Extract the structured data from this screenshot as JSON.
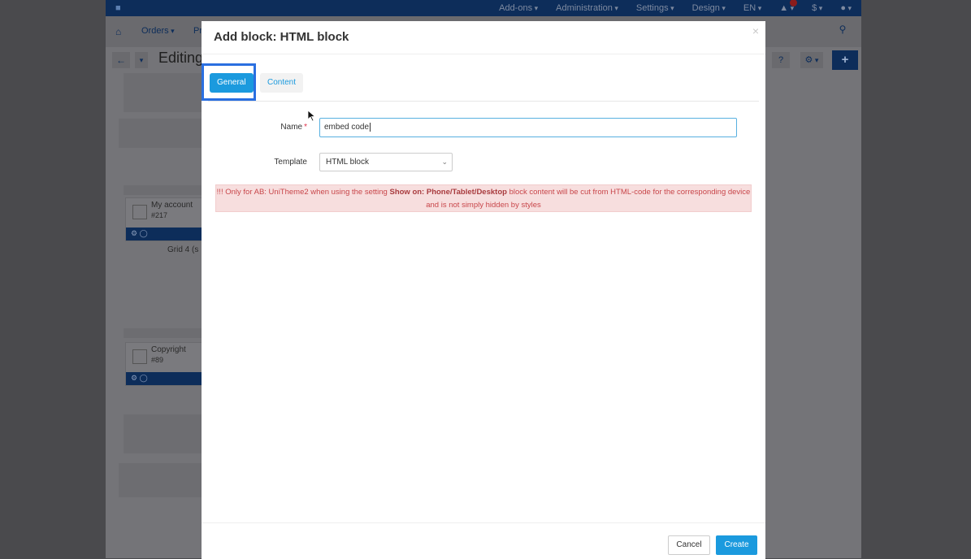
{
  "background": {
    "topbar": {
      "items": [
        "Add-ons",
        "Administration",
        "Settings",
        "Design",
        "EN",
        "",
        "$",
        ""
      ]
    },
    "navbar": {
      "orders": "Orders",
      "pr": "Pr"
    },
    "toolbar": {
      "title": "Editing"
    },
    "blocks": [
      {
        "name": "My account",
        "id": "#217"
      },
      {
        "name": "Copyright",
        "id": "#89"
      }
    ],
    "grid_label": "Grid 4 (s"
  },
  "modal": {
    "title": "Add block: HTML block",
    "close": "×",
    "tabs": {
      "general": "General",
      "content": "Content"
    },
    "form": {
      "name_label": "Name",
      "name_required": "*",
      "name_value": "embed code",
      "template_label": "Template",
      "template_value": "HTML block"
    },
    "alert": {
      "prefix": "!!! Only for AB: UniTheme2 when using the setting ",
      "bold": "Show on: Phone/Tablet/Desktop",
      "suffix": " block content will be cut from HTML-code for the corresponding device and is not simply hidden by styles"
    },
    "footer": {
      "cancel": "Cancel",
      "create": "Create"
    }
  },
  "colors": {
    "accent": "#1b9ade",
    "highlight": "#2a6fe0",
    "alert_bg": "#f7dede",
    "alert_text": "#c8464a"
  }
}
